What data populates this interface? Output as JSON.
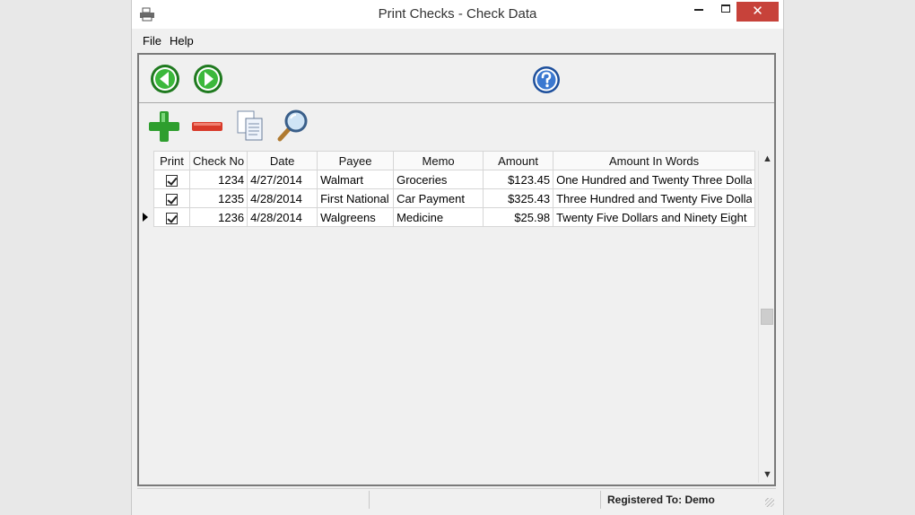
{
  "window": {
    "title": "Print Checks - Check Data",
    "close_glyph": "✕"
  },
  "menu": {
    "file": "File",
    "help": "Help"
  },
  "icons": {
    "back": "arrow-left-icon",
    "forward": "arrow-right-icon",
    "help": "question-mark-icon",
    "add": "plus-icon",
    "remove": "minus-icon",
    "copy": "copy-icon",
    "find": "magnifier-icon"
  },
  "colors": {
    "nav_green": "#2e9e2e",
    "help_blue": "#2a5fb0",
    "remove_red": "#d83a2a",
    "close_red": "#c7423a"
  },
  "grid": {
    "columns": [
      "Print",
      "Check No",
      "Date",
      "Payee",
      "Memo",
      "Amount",
      "Amount In Words"
    ],
    "rows": [
      {
        "print": true,
        "check_no": "1234",
        "date": "4/27/2014",
        "payee": "Walmart",
        "memo": "Groceries",
        "amount": "$123.45",
        "words": "One Hundred and Twenty Three Dolla"
      },
      {
        "print": true,
        "check_no": "1235",
        "date": "4/28/2014",
        "payee": "First National",
        "memo": "Car Payment",
        "amount": "$325.43",
        "words": "Three Hundred and Twenty Five Dolla"
      },
      {
        "print": true,
        "check_no": "1236",
        "date": "4/28/2014",
        "payee": "Walgreens",
        "memo": "Medicine",
        "amount": "$25.98",
        "words": "Twenty Five Dollars and Ninety Eight"
      }
    ],
    "current_row": 3
  },
  "status": {
    "registered": "Registered To: Demo"
  }
}
